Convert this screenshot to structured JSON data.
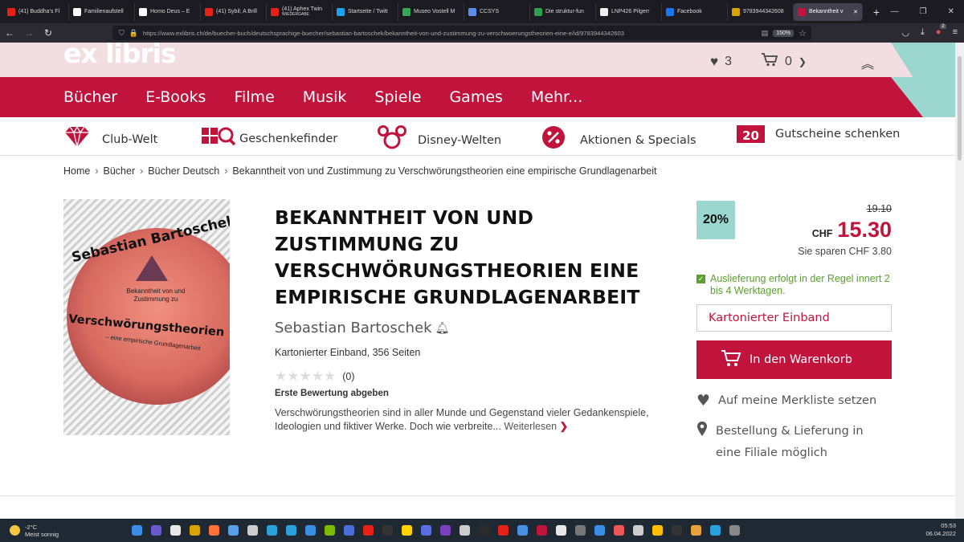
{
  "browser": {
    "tabs": [
      {
        "label": "(41) Buddha's Fl",
        "color": "#e62117"
      },
      {
        "label": "Familienaufstell",
        "color": "#ffffff"
      },
      {
        "label": "Homo Deus – E",
        "color": "#ffffff"
      },
      {
        "label": "(41) Sybil; A Brill",
        "color": "#e62117"
      },
      {
        "label": "(41) Aphex Twin",
        "color": "#e62117"
      },
      {
        "label": "Startseite / Twitt",
        "color": "#1da1f2"
      },
      {
        "label": "Museo Vostell M",
        "color": "#34a853"
      },
      {
        "label": "CCSYS",
        "color": "#5b8def"
      },
      {
        "label": "Die struktur-fun",
        "color": "#2e9e4f"
      },
      {
        "label": "LNP426 Pilgerr",
        "color": "#eeeeee"
      },
      {
        "label": "Facebook",
        "color": "#1877f2"
      },
      {
        "label": "9783944342608",
        "color": "#d9a400"
      },
      {
        "label": "Bekanntheit v",
        "color": "#c0143c"
      }
    ],
    "active_tab_index": 12,
    "aphex_subtitle": "WIEDERGABE",
    "new_tab": "+",
    "url": "https://www.exlibris.ch/de/buecher-buch/deutschsprachige-buecher/sebastian-bartoschek/bekanntheit-von-und-zustimmung-zu-verschwoerungstheorien-eine-e/id/9783944342603",
    "zoom": "150%",
    "extension_badge": "2"
  },
  "site": {
    "logo": "ex libris",
    "wishlist_count": "3",
    "cart_count": "0",
    "main_nav": [
      "Bücher",
      "E-Books",
      "Filme",
      "Musik",
      "Spiele",
      "Games",
      "Mehr..."
    ],
    "sub_nav": [
      {
        "label": "Club-Welt",
        "icon": "diamond-icon"
      },
      {
        "label": "Geschenkefinder",
        "icon": "gift-search-icon"
      },
      {
        "label": "Disney-Welten",
        "icon": "mickey-icon"
      },
      {
        "label": "Aktionen & Specials",
        "icon": "percent-icon"
      },
      {
        "label": "Gutscheine schenken",
        "icon": "voucher-icon",
        "badge": "20"
      }
    ],
    "breadcrumb": [
      "Home",
      "Bücher",
      "Bücher Deutsch",
      "Bekanntheit von und Zustimmung zu Verschwörungstheorien eine empirische Grundlagenarbeit"
    ]
  },
  "cover": {
    "author": "Sebastian Bartoschek",
    "subtitle_top": "Bekanntheit von und Zustimmung zu",
    "main": "Verschwörungstheorien",
    "subtitle_bottom": "– eine empirische Grundlagenarbeit"
  },
  "product": {
    "title": "BEKANNTHEIT VON UND ZUSTIMMUNG ZU VERSCHWÖRUNGSTHEORIEN EINE EMPIRISCHE GRUNDLAGENARBEIT",
    "author": "Sebastian Bartoschek",
    "format": "Kartonierter Einband, 356 Seiten",
    "rating_count": "(0)",
    "rating_value": 0,
    "first_review": "Erste Bewertung abgeben",
    "description": "Verschwörungstheorien sind in aller Munde und Gegenstand vieler Gedankenspiele, Ideologien und fiktiver Werke. Doch wie verbreite...",
    "read_more": "Weiterlesen"
  },
  "pricing": {
    "discount": "20%",
    "old_price": "19.10",
    "currency": "CHF",
    "price": "15.30",
    "savings": "Sie sparen CHF 3.80",
    "delivery": "Auslieferung erfolgt in der Regel innert 2 bis 4 Werktagen.",
    "binding": "Kartonierter Einband",
    "add_to_cart": "In den Warenkorb",
    "wishlist": "Auf meine Merkliste setzen",
    "store": "Bestellung & Lieferung in eine Filiale möglich"
  },
  "taskbar": {
    "temperature": "-2°C",
    "weather": "Meist sonnig",
    "time": "05:53",
    "date": "06.04.2022"
  },
  "colors": {
    "brand_red": "#c0143c",
    "mint": "#9bd6cf",
    "header_pink": "#f2dde1",
    "delivery_green": "#5aa02c"
  }
}
